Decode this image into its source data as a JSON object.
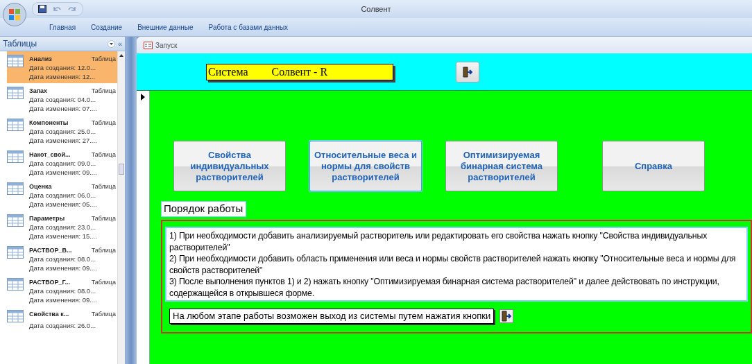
{
  "window": {
    "title": "Солвент"
  },
  "ribbon_tabs": [
    {
      "label": "Главная",
      "selected": false
    },
    {
      "label": "Создание",
      "selected": false
    },
    {
      "label": "Внешние данные",
      "selected": false
    },
    {
      "label": "Работа с базами данных",
      "selected": false
    }
  ],
  "navigation": {
    "title": "Таблицы",
    "collapse": "«",
    "items": [
      {
        "name": "Анализ",
        "type": "Таблица",
        "created": "Дата создания: 12.0...",
        "modified": "Дата изменения: 12...",
        "selected": true
      },
      {
        "name": "Запах",
        "type": "Таблица",
        "created": "Дата создания: 04.0...",
        "modified": "Дата изменения: 07....",
        "selected": false
      },
      {
        "name": "Компоненты",
        "type": "Таблица",
        "created": "Дата создания: 25.0...",
        "modified": "Дата изменения: 27....",
        "selected": false
      },
      {
        "name": "Накот_свой...",
        "type": "Таблица",
        "created": "Дата создания: 09.0...",
        "modified": "Дата изменения: 09....",
        "selected": false
      },
      {
        "name": "Оценка",
        "type": "Таблица",
        "created": "Дата создания: 06.0...",
        "modified": "Дата изменения: 05....",
        "selected": false
      },
      {
        "name": "Параметры",
        "type": "Таблица",
        "created": "Дата создания: 23.0...",
        "modified": "Дата изменения: 15....",
        "selected": false
      },
      {
        "name": "РАСТВОР_В...",
        "type": "Таблица",
        "created": "Дата создания: 08.0...",
        "modified": "Дата изменения: 09....",
        "selected": false
      },
      {
        "name": "РАСТВОР_Г...",
        "type": "Таблица",
        "created": "Дата создания: 08.0...",
        "modified": "Дата изменения: 09....",
        "selected": false
      },
      {
        "name": "Свойства к...",
        "type": "Таблица",
        "created": "Дата создания: 26.0...",
        "selected": false
      }
    ]
  },
  "document_tab": {
    "label": "Запуск"
  },
  "form": {
    "title_left": "Система",
    "title_right": "Солвент - R",
    "buttons": [
      {
        "label": "Свойства индивидуальных растворителей",
        "selected": false
      },
      {
        "label": "Относительные веса и нормы для свойств растворителей",
        "selected": true
      },
      {
        "label": "Оптимизируемая бинарная система растворителей",
        "selected": false
      },
      {
        "label": "Справка",
        "selected": false
      }
    ],
    "section_label": "Порядок работы",
    "instructions": [
      "1) При необходимости добавить  анализируемый растворитель или редактировать его свойства нажать кнопку \"Свойства индивидуальных растворителей\"",
      "2) При необходимости добавить область применения или веса и нормы свойств растворителей нажать кнопку \"Относительные веса и нормы для свойств растворителей\"",
      "3) После выполнения пунктов 1) и 2) нажать кнопку \"Оптимизируемая бинарная система растворителей\" и далее действовать по  инструкции, содержащейся в открывшеся форме."
    ],
    "exit_note": "На любом этапе работы возможен выход из системы путем нажатия кнопки"
  }
}
